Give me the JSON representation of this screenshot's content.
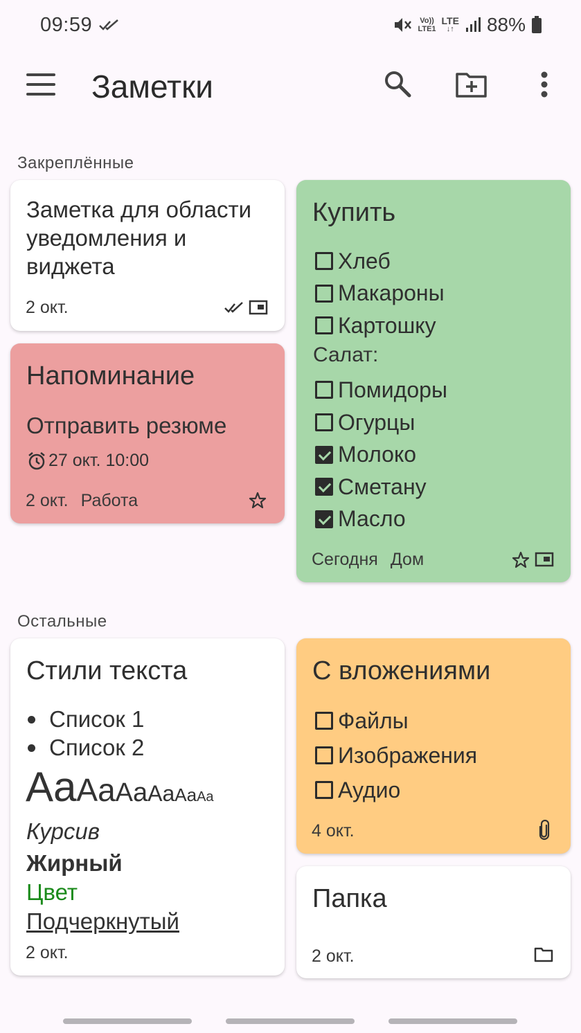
{
  "status_bar": {
    "time": "09:59",
    "volte_top": "Vo))",
    "volte_bottom": "LTE1",
    "network": "LTE",
    "battery_pct": "88%"
  },
  "app_bar": {
    "title": "Заметки",
    "icons": [
      "menu-icon",
      "search-icon",
      "new-folder-icon",
      "more-vert-icon"
    ]
  },
  "sections": {
    "pinned": "Закреплённые",
    "others": "Остальные"
  },
  "notes": {
    "widget": {
      "title": "Заметка для области уведомления и виджета",
      "date": "2 окт.",
      "icons": [
        "done-all-icon",
        "widget-icon"
      ]
    },
    "reminder": {
      "title": "Напоминание",
      "body": "Отправить резюме",
      "alarm": "27 окт. 10:00",
      "date": "2 окт.",
      "label": "Работа",
      "color": "#ec9f9f"
    },
    "buy": {
      "title": "Купить",
      "color": "#a7d7a9",
      "items": [
        {
          "text": "Хлеб",
          "type": "check",
          "checked": false
        },
        {
          "text": "Макароны",
          "type": "check",
          "checked": false
        },
        {
          "text": "Картошку",
          "type": "check",
          "checked": false
        },
        {
          "text": "Салат:",
          "type": "text",
          "checked": false
        },
        {
          "text": "Помидоры",
          "type": "check",
          "checked": false
        },
        {
          "text": "Огурцы",
          "type": "check",
          "checked": false
        },
        {
          "text": "Молоко",
          "type": "check",
          "checked": true
        },
        {
          "text": "Сметану",
          "type": "check",
          "checked": true
        },
        {
          "text": "Масло",
          "type": "check",
          "checked": true
        }
      ],
      "date": "Сегодня",
      "label": "Дом"
    },
    "styles": {
      "title": "Стили текста",
      "bullets": [
        "Список 1",
        "Список 2"
      ],
      "sizes": [
        "Aa",
        "Aa",
        "Aa",
        "Aa",
        "Aa",
        "Aa"
      ],
      "italic": "Курсив",
      "bold": "Жирный",
      "colored": "Цвет",
      "colored_color": "#1a8a1a",
      "underline": "Подчеркнутый",
      "date": "2 окт."
    },
    "attachments": {
      "title": "С вложениями",
      "color": "#ffcc82",
      "items": [
        "Файлы",
        "Изображения",
        "Аудио"
      ],
      "date": "4 окт."
    },
    "folder": {
      "title": "Папка",
      "date": "2 окт."
    }
  }
}
